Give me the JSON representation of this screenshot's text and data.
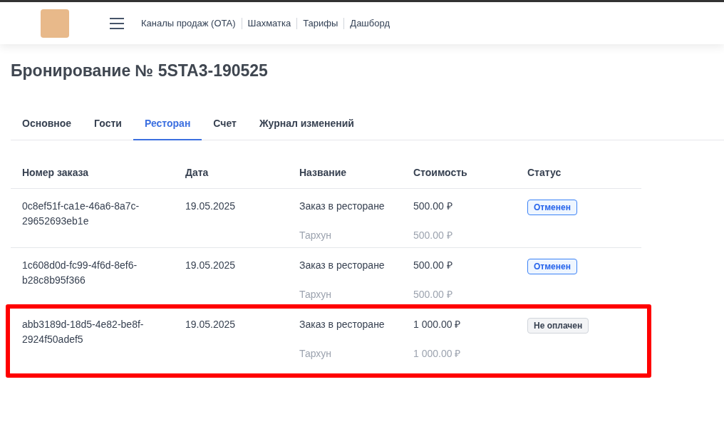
{
  "nav": {
    "links": [
      "Каналы продаж (OTA)",
      "Шахматка",
      "Тарифы",
      "Дашборд"
    ]
  },
  "title": "Бронирование № 5STA3-190525",
  "tabs": [
    {
      "label": "Основное",
      "selected": false
    },
    {
      "label": "Гости",
      "selected": false
    },
    {
      "label": "Ресторан",
      "selected": true
    },
    {
      "label": "Счет",
      "selected": false
    },
    {
      "label": "Журнал изменений",
      "selected": false
    }
  ],
  "table": {
    "columns": [
      "Номер заказа",
      "Дата",
      "Название",
      "Стоимость",
      "Статус"
    ],
    "rows": [
      {
        "order_number": "0c8ef51f-ca1e-46a6-8a7c-29652693eb1e",
        "date": "19.05.2025",
        "name": "Заказ в ресторане",
        "cost": "500.00 ₽",
        "status": {
          "label": "Отменен",
          "kind": "cancelled"
        },
        "items": [
          {
            "name": "Тархун",
            "cost": "500.00 ₽"
          }
        ],
        "highlighted": false
      },
      {
        "order_number": "1c608d0d-fc99-4f6d-8ef6-b28c8b95f366",
        "date": "19.05.2025",
        "name": "Заказ в ресторане",
        "cost": "500.00 ₽",
        "status": {
          "label": "Отменен",
          "kind": "cancelled"
        },
        "items": [
          {
            "name": "Тархун",
            "cost": "500.00 ₽"
          }
        ],
        "highlighted": false
      },
      {
        "order_number": "abb3189d-18d5-4e82-be8f-2924f50adef5",
        "date": "19.05.2025",
        "name": "Заказ в ресторане",
        "cost": "1 000.00 ₽",
        "status": {
          "label": "Не оплачен",
          "kind": "unpaid"
        },
        "items": [
          {
            "name": "Тархун",
            "cost": "1 000.00 ₽"
          }
        ],
        "highlighted": true
      }
    ]
  }
}
